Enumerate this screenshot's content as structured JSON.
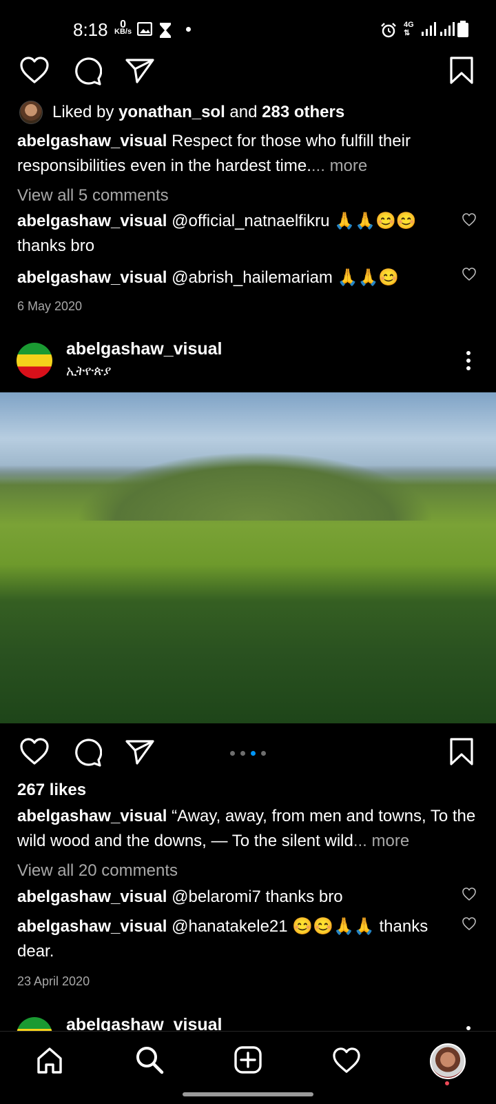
{
  "status_bar": {
    "time": "8:18",
    "speed_value": "0",
    "speed_unit": "KB/s",
    "network": "4G"
  },
  "post1": {
    "liked_by_prefix": "Liked by ",
    "liked_by_user": "yonathan_sol",
    "liked_by_mid": " and ",
    "liked_by_others": "283 others",
    "caption_user": "abelgashaw_visual",
    "caption_text": "Respect for those who fulfill their responsibilities even in the hardest time.",
    "caption_more": "... more",
    "view_comments": "View all 5 comments",
    "comments": [
      {
        "user": "abelgashaw_visual",
        "text": "@official_natnaelfikru 🙏🙏😊😊 thanks bro"
      },
      {
        "user": "abelgashaw_visual",
        "text": "@abrish_hailemariam 🙏🙏😊"
      }
    ],
    "date": "6 May 2020"
  },
  "post2": {
    "username": "abelgashaw_visual",
    "location": "ኢትዮጵያ",
    "likes": "267 likes",
    "caption_user": "abelgashaw_visual",
    "caption_text": "“Away, away, from men and towns,  To the wild wood and the downs, —  To the silent wild",
    "caption_more": "... more",
    "view_comments": "View all 20 comments",
    "comments": [
      {
        "user": "abelgashaw_visual",
        "text": "@belaromi7 thanks bro"
      },
      {
        "user": "abelgashaw_visual",
        "text": "@hanatakele21 😊😊🙏🙏 thanks dear."
      }
    ],
    "date": "23 April 2020",
    "carousel_total": 4,
    "carousel_active": 3
  },
  "post3": {
    "username": "abelgashaw_visual"
  },
  "icons": {
    "like": "heart-icon",
    "comment": "comment-icon",
    "share": "send-icon",
    "save": "bookmark-icon",
    "more": "more-vertical-icon",
    "nav": [
      "home-icon",
      "search-icon",
      "create-icon",
      "activity-icon",
      "profile-avatar"
    ]
  },
  "colors": {
    "background": "#000000",
    "text": "#ffffff",
    "secondary_text": "#a8a8a8",
    "carousel_active": "#0095f6",
    "notification_dot": "#ed4956"
  }
}
